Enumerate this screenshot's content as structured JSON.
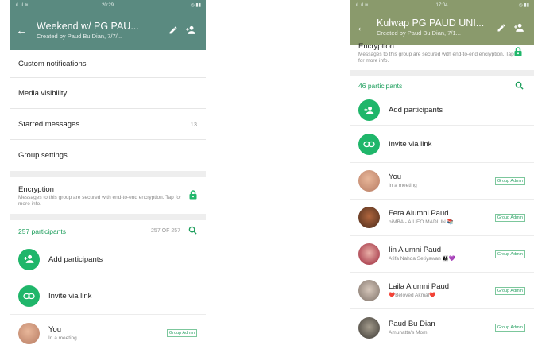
{
  "left": {
    "statusbar": {
      "time": "20:29"
    },
    "appbar": {
      "title": "Weekend w/ PG PAU...",
      "subtitle": "Created by Paud Bu Dian, 7/7/..."
    },
    "settings": [
      "Custom notifications",
      "Media visibility",
      "Starred messages",
      "Group settings"
    ],
    "starred_count": "13",
    "encryption": {
      "title": "Encryption",
      "description": "Messages to this group are secured with end-to-end encryption. Tap for more info."
    },
    "participants_header": {
      "count": "257 participants",
      "of": "257 OF 257"
    },
    "actions": [
      "Add participants",
      "Invite via link"
    ],
    "members": [
      {
        "name": "You",
        "status": "In a meeting",
        "badge": "Group Admin",
        "avatar_color": "#c98e72"
      }
    ]
  },
  "right": {
    "statusbar": {
      "time": "17:04"
    },
    "appbar": {
      "title": "Kulwap PG PAUD UNI...",
      "subtitle": "Created by Paud Bu Dian, 7/1..."
    },
    "encryption": {
      "title": "Encryption",
      "description": "Messages to this group are secured with end-to-end encryption. Tap for more info."
    },
    "participants_header": {
      "count": "46 participants"
    },
    "actions": [
      "Add participants",
      "Invite via link"
    ],
    "members": [
      {
        "name": "You",
        "status": "In a meeting",
        "badge": "Group Admin",
        "avatar_color": "#c98e72"
      },
      {
        "name": "Fera Alumni Paud",
        "status": "biMBA - AIUEO MADIUN 📚",
        "badge": "Group Admin",
        "avatar_color": "#7a4a2e"
      },
      {
        "name": "Iin Alumni Paud",
        "status": "Afifa Nahda Setiyawan 👪💜",
        "badge": "Group Admin",
        "avatar_color": "#b43848"
      },
      {
        "name": "Laila Alumni Paud",
        "status": "❤️Beloved Akmal❤️",
        "badge": "Group Admin",
        "avatar_color": "#9a8e84"
      },
      {
        "name": "Paud Bu Dian",
        "status": "Amunatta's Mom",
        "badge": "Group Admin",
        "avatar_color": "#4f4c47"
      }
    ]
  }
}
